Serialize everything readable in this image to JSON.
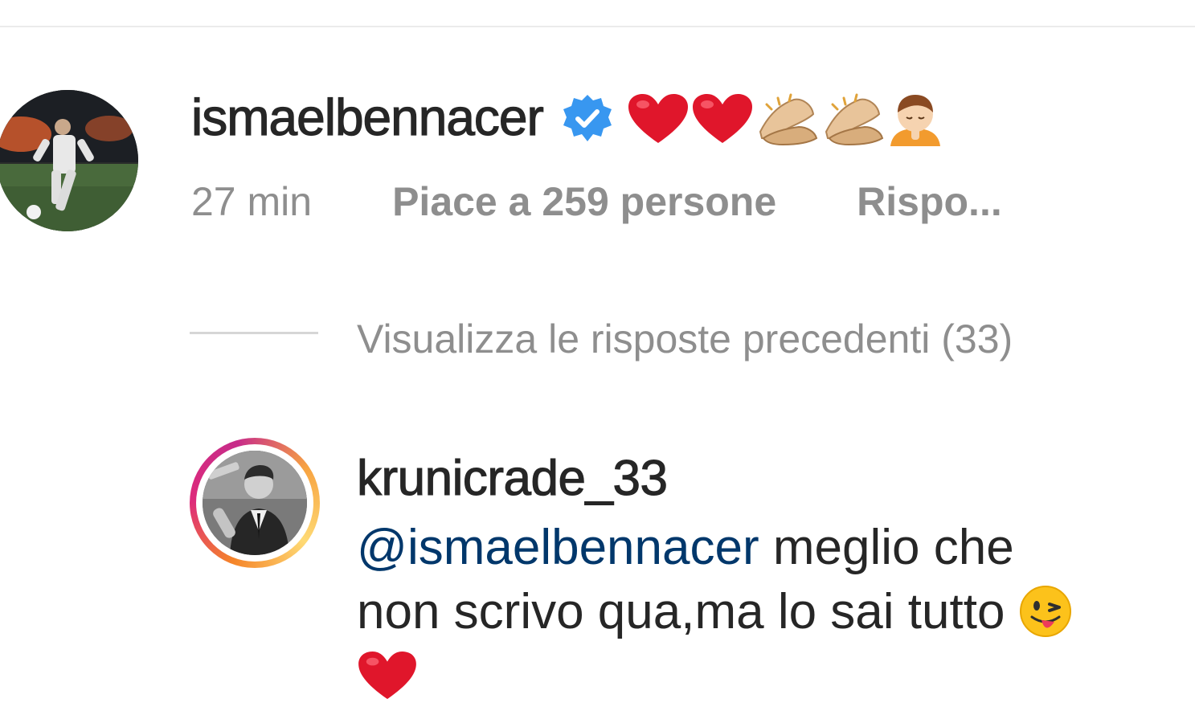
{
  "comment_1": {
    "username": "ismaelbennacer",
    "verified": true,
    "text_emojis": [
      "red-heart-icon",
      "red-heart-icon",
      "clapping-hands-icon",
      "clapping-hands-icon",
      "person-bowing-icon"
    ],
    "time": "27 min",
    "likes": "Piace a 259 persone",
    "reply": "Rispo..."
  },
  "view_replies": {
    "label": "Visualizza le risposte precedenti (33)"
  },
  "comment_2": {
    "username": "krunicrade_33",
    "mention": "@ismaelbennacer",
    "text_line_1": " meglio che",
    "text_line_2": "non scrivo qua,ma lo sai tutto ",
    "trailing_emojis": [
      "winking-face-tongue-icon",
      "red-heart-icon"
    ]
  },
  "colors": {
    "primary_text": "#262626",
    "secondary_text": "#8e8e8e",
    "mention_link": "#00376b",
    "verified_blue": "#3897f0",
    "story_ring_start": "#f58529",
    "story_ring_end": "#dd2a7b"
  }
}
